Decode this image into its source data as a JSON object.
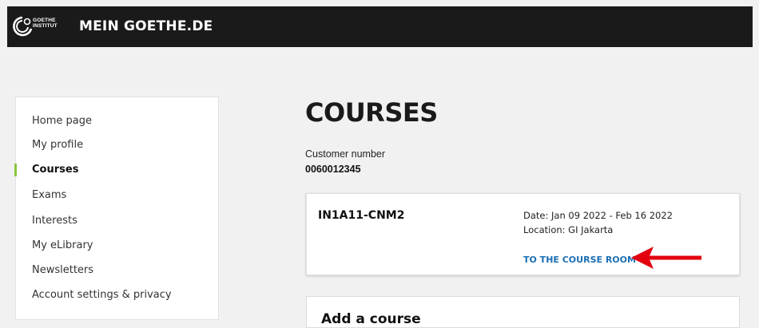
{
  "header": {
    "logo_line1": "GOETHE",
    "logo_line2": "INSTITUT",
    "site_title": "MEIN GOETHE.DE"
  },
  "sidebar": {
    "items": [
      {
        "label": "Home page",
        "active": false
      },
      {
        "label": "My profile",
        "active": false
      },
      {
        "label": "Courses",
        "active": true
      },
      {
        "label": "Exams",
        "active": false
      },
      {
        "label": "Interests",
        "active": false
      },
      {
        "label": "My eLibrary",
        "active": false
      },
      {
        "label": "Newsletters",
        "active": false
      },
      {
        "label": "Account settings & privacy",
        "active": false
      }
    ]
  },
  "main": {
    "title": "COURSES",
    "customer_label": "Customer number",
    "customer_number": "0060012345",
    "course": {
      "code": "IN1A11-CNM2",
      "date": "Date: Jan 09 2022 - Feb 16 2022",
      "location": "Location: GI Jakarta",
      "link": "TO THE COURSE ROOM »"
    },
    "add_course_title": "Add a course"
  },
  "colors": {
    "topbar": "#1a1a1a",
    "active_marker": "#8dc63f",
    "link": "#1a6fb5",
    "annotation_arrow": "#e3000f"
  }
}
